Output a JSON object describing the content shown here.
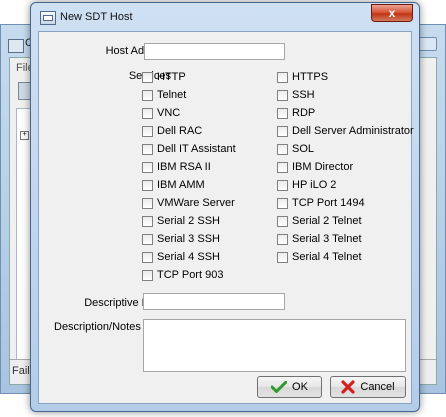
{
  "background_window": {
    "title_fragment": "C",
    "menu_fragment": "File",
    "status_fragment": "Faile"
  },
  "dialog": {
    "title": "New SDT Host",
    "close_glyph": "x",
    "host_address": {
      "label": "Host Address",
      "value": ""
    },
    "services": {
      "label": "Services",
      "left": [
        {
          "label": "HTTP",
          "checked": false
        },
        {
          "label": "Telnet",
          "checked": false
        },
        {
          "label": "VNC",
          "checked": false
        },
        {
          "label": "Dell RAC",
          "checked": false
        },
        {
          "label": "Dell IT Assistant",
          "checked": false
        },
        {
          "label": "IBM RSA II",
          "checked": false
        },
        {
          "label": "IBM AMM",
          "checked": false
        },
        {
          "label": "VMWare Server",
          "checked": false
        },
        {
          "label": "Serial 2 SSH",
          "checked": false
        },
        {
          "label": "Serial 3 SSH",
          "checked": false
        },
        {
          "label": "Serial 4 SSH",
          "checked": false
        },
        {
          "label": "TCP Port 903",
          "checked": false
        }
      ],
      "right": [
        {
          "label": "HTTPS",
          "checked": false
        },
        {
          "label": "SSH",
          "checked": false
        },
        {
          "label": "RDP",
          "checked": false
        },
        {
          "label": "Dell Server Administrator",
          "checked": false
        },
        {
          "label": "SOL",
          "checked": false
        },
        {
          "label": "IBM Director",
          "checked": false
        },
        {
          "label": "HP iLO 2",
          "checked": false
        },
        {
          "label": "TCP Port 1494",
          "checked": false
        },
        {
          "label": "Serial 2 Telnet",
          "checked": false
        },
        {
          "label": "Serial 3 Telnet",
          "checked": false
        },
        {
          "label": "Serial 4 Telnet",
          "checked": false
        }
      ]
    },
    "descriptive_name": {
      "label": "Descriptive Name",
      "value": ""
    },
    "description_notes": {
      "label": "Description/Notes",
      "value": ""
    },
    "buttons": {
      "ok": {
        "label": "OK",
        "icon": "checkmark-icon",
        "color": "#2e9a2e"
      },
      "cancel": {
        "label": "Cancel",
        "icon": "red-x-icon",
        "color": "#d42020"
      }
    }
  }
}
